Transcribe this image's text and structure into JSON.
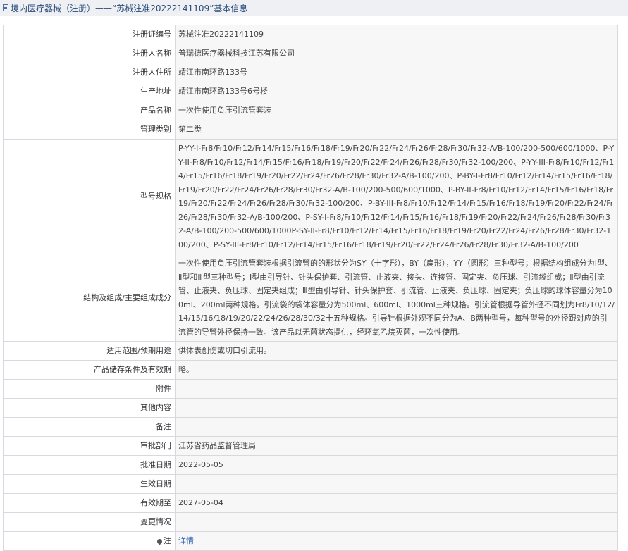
{
  "header": {
    "title": "境内医疗器械（注册）——“苏械注准20222141109”基本信息"
  },
  "rows": [
    {
      "label": "注册证编号",
      "value": "苏械注准20222141109"
    },
    {
      "label": "注册人名称",
      "value": "普瑞德医疗器械科技江苏有限公司"
    },
    {
      "label": "注册人住所",
      "value": "靖江市南环路133号"
    },
    {
      "label": "生产地址",
      "value": "靖江市南环路133号6号楼"
    },
    {
      "label": "产品名称",
      "value": "一次性使用负压引流管套装"
    },
    {
      "label": "管理类别",
      "value": "第二类"
    },
    {
      "label": "型号规格",
      "value": "P-YY-I-Fr8/Fr10/Fr12/Fr14/Fr15/Fr16/Fr18/Fr19/Fr20/Fr22/Fr24/Fr26/Fr28/Fr30/Fr32-A/B-100/200-500/600/1000、P-YY-II-Fr8/Fr10/Fr12/Fr14/Fr15/Fr16/Fr18/Fr19/Fr20/Fr22/Fr24/Fr26/Fr28/Fr30/Fr32-100/200、P-YY-III-Fr8/Fr10/Fr12/Fr14/Fr15/Fr16/Fr18/Fr19/Fr20/Fr22/Fr24/Fr26/Fr28/Fr30/Fr32-A/B-100/200、P-BY-I-Fr8/Fr10/Fr12/Fr14/Fr15/Fr16/Fr18/Fr19/Fr20/Fr22/Fr24/Fr26/Fr28/Fr30/Fr32-A/B-100/200-500/600/1000、P-BY-II-Fr8/Fr10/Fr12/Fr14/Fr15/Fr16/Fr18/Fr19/Fr20/Fr22/Fr24/Fr26/Fr28/Fr30/Fr32-100/200、P-BY-III-Fr8/Fr10/Fr12/Fr14/Fr15/Fr16/Fr18/Fr19/Fr20/Fr22/Fr24/Fr26/Fr28/Fr30/Fr32-A/B-100/200、P-SY-I-Fr8/Fr10/Fr12/Fr14/Fr15/Fr16/Fr18/Fr19/Fr20/Fr22/Fr24/Fr26/Fr28/Fr30/Fr32-A/B-100/200-500/600/1000P-SY-II-Fr8/Fr10/Fr12/Fr14/Fr15/Fr16/Fr18/Fr19/Fr20/Fr22/Fr24/Fr26/Fr28/Fr30/Fr32-100/200、P-SY-III-Fr8/Fr10/Fr12/Fr14/Fr15/Fr16/Fr18/Fr19/Fr20/Fr22/Fr24/Fr26/Fr28/Fr30/Fr32-A/B-100/200"
    },
    {
      "label": "结构及组成/主要组成成分",
      "value": "一次性使用负压引流管套装根据引流管的的形状分为SY（十字形），BY（扁形），YY（圆形）三种型号；根据结构组成分为Ⅰ型、Ⅱ型和Ⅲ型三种型号；Ⅰ型由引导针、针头保护套、引流管、止液夹、接头、连接管、固定夹、负压球、引流袋组成；Ⅱ型由引流管、止液夹、负压球、固定夹组成；Ⅲ型由引导针、针头保护套、引流管、止液夹、负压球、固定夹；负压球的球体容量分为100ml、200ml两种规格。引流袋的袋体容量分为500ml、600ml、1000ml三种规格。引流管根据导管外径不同划为Fr8/10/12/14/15/16/18/19/20/22/24/26/28/30/32十五种规格。引导针根据外观不同分为A、B两种型号，每种型号的外径跟对应的引流管的导管外径保持一致。该产品以无菌状态提供，经环氧乙烷灭菌，一次性使用。"
    },
    {
      "label": "适用范围/预期用途",
      "value": "供体表创伤或切口引流用。"
    },
    {
      "label": "产品储存条件及有效期",
      "value": "略。"
    },
    {
      "label": "附件",
      "value": ""
    },
    {
      "label": "其他内容",
      "value": ""
    },
    {
      "label": "备注",
      "value": ""
    },
    {
      "label": "审批部门",
      "value": "江苏省药品监督管理局"
    },
    {
      "label": "批准日期",
      "value": "2022-05-05"
    },
    {
      "label": "生效日期",
      "value": ""
    },
    {
      "label": "有效期至",
      "value": "2027-05-04"
    },
    {
      "label": "变更情况",
      "value": ""
    },
    {
      "label": "注",
      "value": "详情"
    }
  ]
}
